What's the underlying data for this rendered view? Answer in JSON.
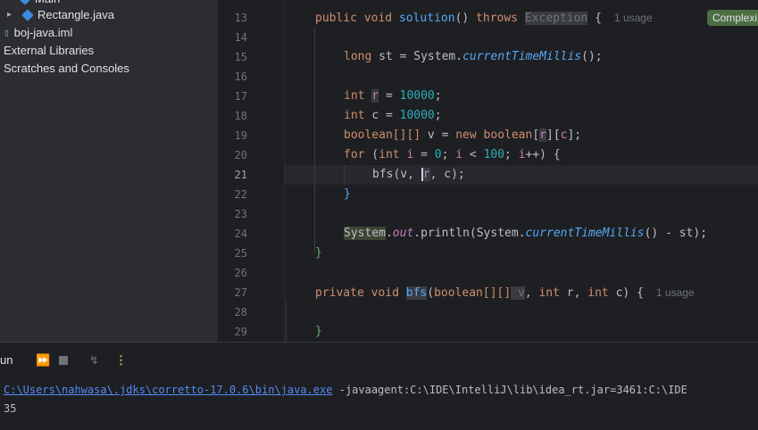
{
  "project_tree": {
    "items": [
      {
        "label": "Main",
        "icon": "cube-icon"
      },
      {
        "label": "Rectangle.java",
        "icon": "java-class-icon"
      },
      {
        "label": "boj-java.iml",
        "icon": "iml-file-icon"
      },
      {
        "label": "External Libraries",
        "icon": ""
      },
      {
        "label": "Scratches and Consoles",
        "icon": ""
      }
    ]
  },
  "editor": {
    "line_numbers": [
      "13",
      "14",
      "15",
      "16",
      "17",
      "18",
      "19",
      "20",
      "21",
      "22",
      "23",
      "24",
      "25",
      "26",
      "27",
      "28",
      "29"
    ],
    "current_line": "21",
    "complexity_badge": "Complexi",
    "usage_1": "1 usage",
    "usage_2": "1 usage",
    "tokens": {
      "public": "public",
      "void": "void",
      "solution": "solution",
      "paren_open_close": "()",
      "throws": "throws",
      "exception": "Exception",
      "brace_open": "{",
      "long": "long",
      "st_assign": " st = ",
      "system": "System",
      "dot": ".",
      "current_time_millis": "currentTimeMillis",
      "call_end": "();",
      "int": "int",
      "r": "r",
      "eq": " = ",
      "n10000": "10000",
      "semi": ";",
      "c": "c",
      "boolean_arr": "boolean[][]",
      "v_assign": " v = ",
      "new": "new",
      "boolean": "boolean",
      "lb": "[",
      "rb": "]",
      "rb_lb": "][",
      "end_br": "];",
      "for": "for",
      "paren_open": " (",
      "i": "i",
      "n0": "0",
      "semi_sp": "; ",
      "lt": " < ",
      "n100": "100",
      "pp": "++) {",
      "bfs": "bfs",
      "bfs_open": "(v, ",
      "bfs_close": ", c);",
      "brace_close": "}",
      "out": "out",
      "println": ".println(",
      "minus_st": "() - st);",
      "private": "private",
      "bfs_def_open": "(",
      "bfs_def_mid": " v",
      "comma_sp": ", ",
      "r_param": " r",
      "c_param": " c) {"
    }
  },
  "run_panel": {
    "label": "un",
    "console_path": "C:\\Users\\nahwasa\\.jdks\\corretto-17.0.6\\bin\\java.exe",
    "console_args": " -javaagent:C:\\IDE\\IntelliJ\\lib\\idea_rt.jar=3461:C:\\IDE",
    "console_output": "35"
  },
  "colors": {
    "keyword": "#cf8e6d",
    "function": "#56a8f5",
    "number": "#2aacb8",
    "field": "#c77dbb",
    "link": "#548af7"
  }
}
